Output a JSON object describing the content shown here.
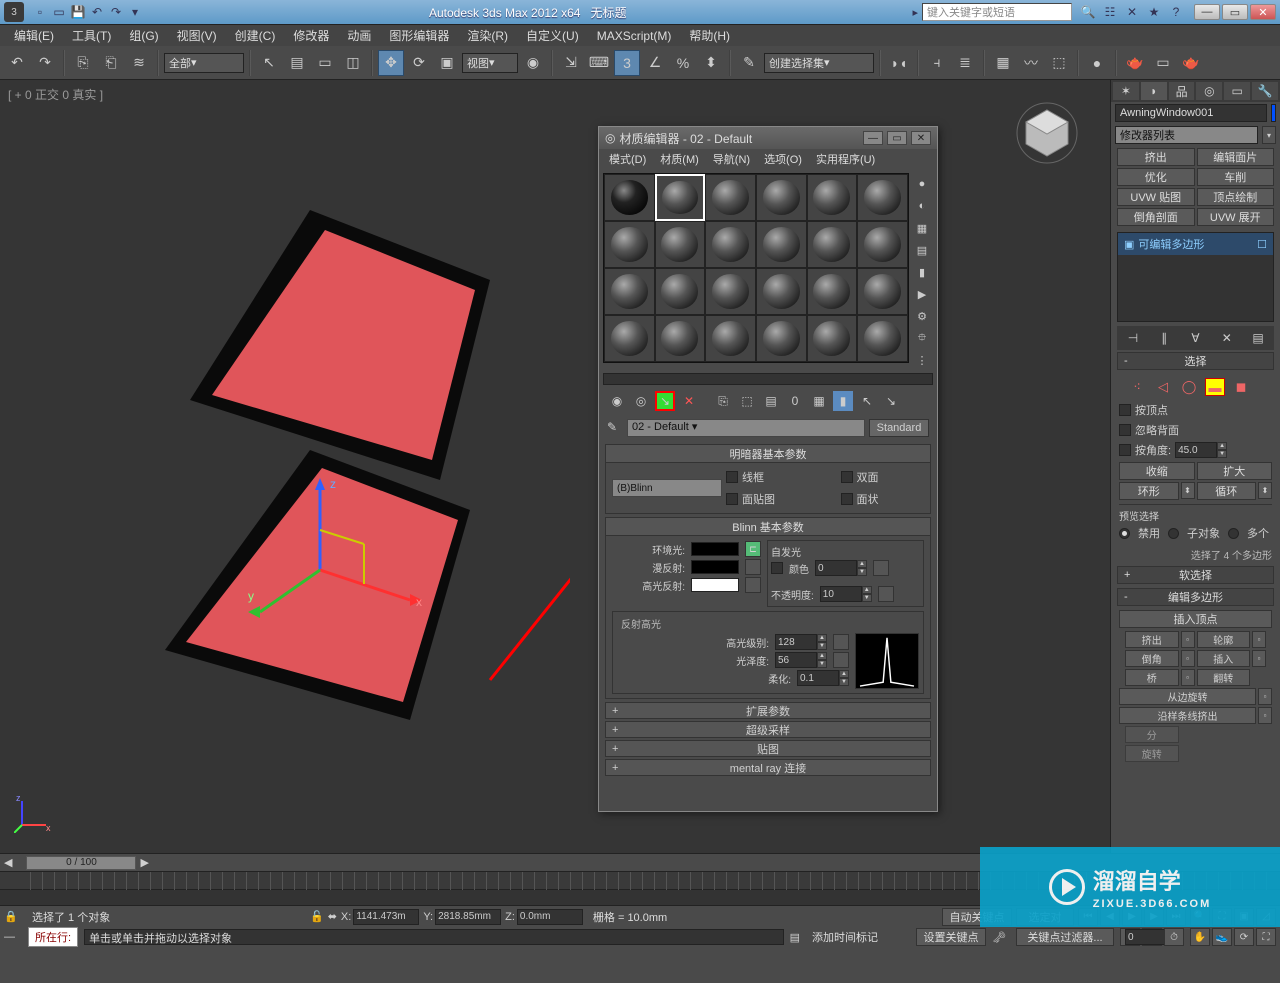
{
  "app": {
    "title_prefix": "Autodesk 3ds Max 2012 x64",
    "title_doc": "无标题",
    "search_placeholder": "键入关键字或短语"
  },
  "menubar": [
    "编辑(E)",
    "工具(T)",
    "组(G)",
    "视图(V)",
    "创建(C)",
    "修改器",
    "动画",
    "图形编辑器",
    "渲染(R)",
    "自定义(U)",
    "MAXScript(M)",
    "帮助(H)"
  ],
  "toolbar": {
    "filter_all": "全部",
    "ref_coord": "视图",
    "named_sel": "创建选择集"
  },
  "viewport": {
    "label": "[ + 0 正交 0 真实 ]"
  },
  "cmd_panel": {
    "object_name": "AwningWindow001",
    "modifier_list": "修改器列表",
    "mod_buttons": [
      "挤出",
      "编辑面片",
      "优化",
      "车削",
      "UVW 贴图",
      "顶点绘制",
      "倒角剖面",
      "UVW 展开"
    ],
    "stack_item": "可编辑多边形",
    "rollouts": {
      "selection": "选择",
      "chk_by_vertex": "按顶点",
      "chk_ignore_back": "忽略背面",
      "chk_by_angle": "按角度:",
      "angle_val": "45.0",
      "btn_shrink": "收缩",
      "btn_grow": "扩大",
      "ring_label": "环形",
      "loop_label": "循环",
      "preview_sel": "预览选择",
      "radio_off": "禁用",
      "radio_sub": "子对象",
      "radio_multi": "多个",
      "sel_status": "选择了 4 个多边形",
      "soft_sel": "软选择",
      "edit_poly": "编辑多边形",
      "insert_vertex": "插入顶点",
      "extrude": "挤出",
      "outline": "轮廓",
      "bevel": "倒角",
      "inset": "插入",
      "bridge": "桥",
      "flip": "翻转",
      "hinge": "从边旋转",
      "extrude_spline": "沿样条线挤出",
      "retri_label": "分",
      "rotate_label": "旋转"
    }
  },
  "material_editor": {
    "title": "材质编辑器 - 02 - Default",
    "menus": [
      "模式(D)",
      "材质(M)",
      "导航(N)",
      "选项(O)",
      "实用程序(U)"
    ],
    "current_name": "02 - Default",
    "type_btn": "Standard",
    "rollout_shader": "明暗器基本参数",
    "shader_type": "(B)Blinn",
    "chk_wire": "线框",
    "chk_2side": "双面",
    "chk_facemap": "面贴图",
    "chk_faceted": "面状",
    "rollout_blinn": "Blinn 基本参数",
    "ambient": "环境光:",
    "diffuse": "漫反射:",
    "specular": "高光反射:",
    "self_illum": "自发光",
    "self_color": "颜色",
    "self_val": "0",
    "opacity": "不透明度:",
    "opacity_val": "10",
    "spec_hl": "反射高光",
    "spec_level": "高光级别:",
    "spec_level_val": "128",
    "glossiness": "光泽度:",
    "gloss_val": "56",
    "soften": "柔化:",
    "soften_val": "0.1",
    "rollout_ext": "扩展参数",
    "rollout_ss": "超级采样",
    "rollout_maps": "贴图",
    "rollout_mr": "mental ray 连接"
  },
  "status": {
    "sel_msg": "选择了 1 个对象",
    "prompt_label": "所在行:",
    "prompt_msg": "单击或单击并拖动以选择对象",
    "x_label": "X:",
    "y_label": "Y:",
    "z_label": "Z:",
    "x_val": "1141.473m",
    "y_val": "2818.85mm",
    "z_val": "0.0mm",
    "grid": "栅格 = 10.0mm",
    "add_time_tag": "添加时间标记",
    "auto_key": "自动关键点",
    "set_key": "设置关键点",
    "sel_filter": "选定对",
    "key_filter": "关键点过滤器...",
    "frame_display": "0 / 100"
  },
  "watermark": {
    "brand": "溜溜自学",
    "url": "ZIXUE.3D66.COM"
  }
}
